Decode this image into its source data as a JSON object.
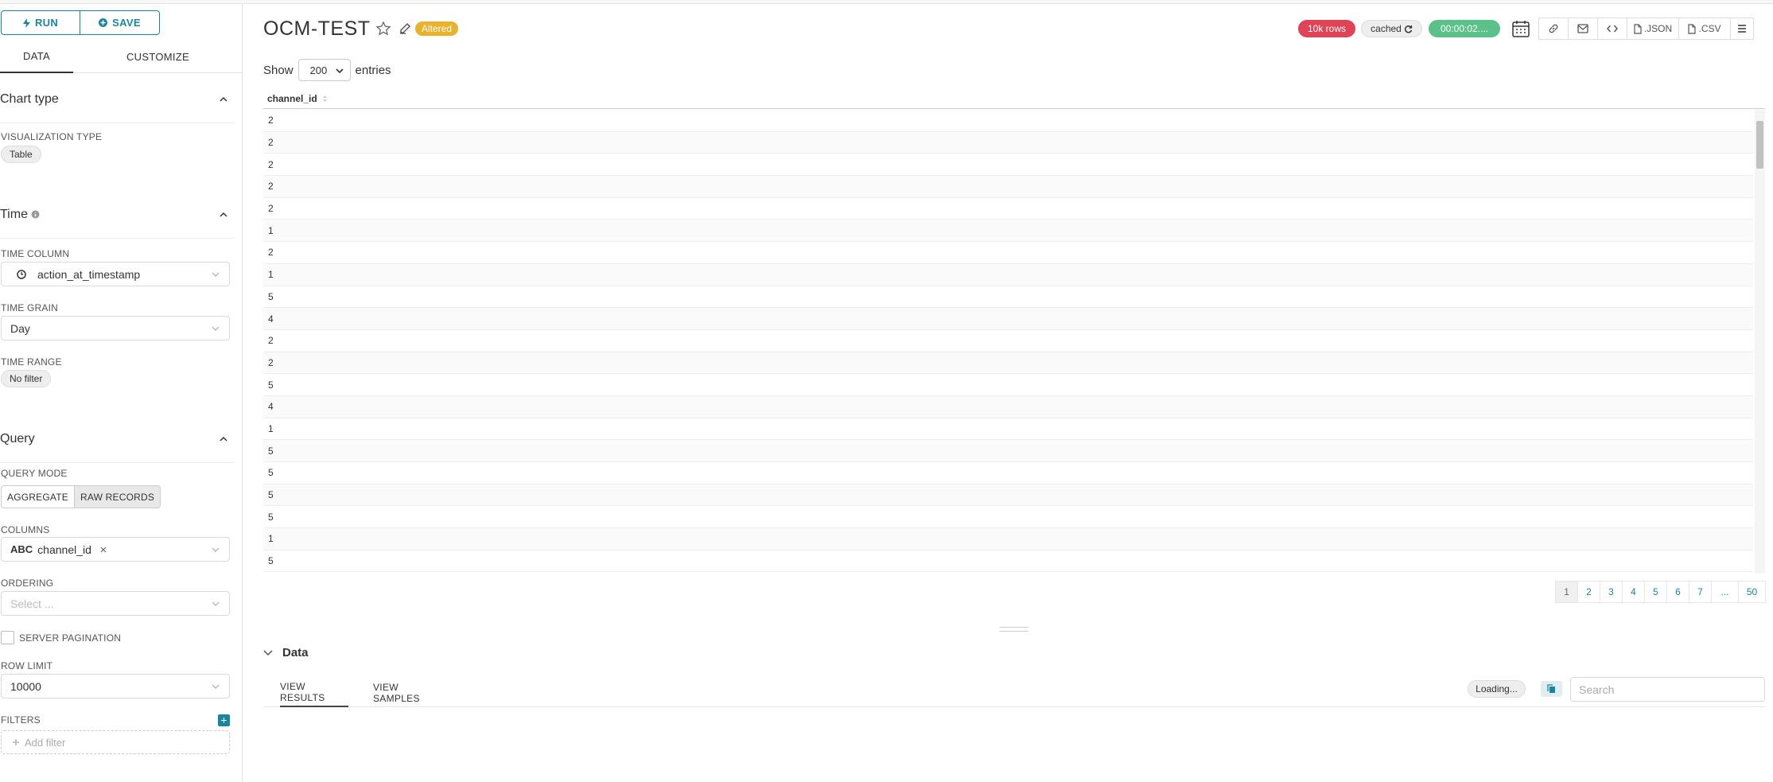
{
  "toolbar_left": {
    "run_label": "RUN",
    "save_label": "SAVE"
  },
  "left_tabs": {
    "data": "DATA",
    "customize": "CUSTOMIZE"
  },
  "chart_type": {
    "heading": "Chart type",
    "viz_label": "VISUALIZATION TYPE",
    "viz_value": "Table"
  },
  "time": {
    "heading": "Time",
    "column_label": "TIME COLUMN",
    "column_value": "action_at_timestamp",
    "grain_label": "TIME GRAIN",
    "grain_value": "Day",
    "range_label": "TIME RANGE",
    "range_value": "No filter"
  },
  "query": {
    "heading": "Query",
    "mode_label": "QUERY MODE",
    "mode_aggregate": "AGGREGATE",
    "mode_raw": "RAW RECORDS",
    "columns_label": "COLUMNS",
    "column_type": "ABC",
    "column_value": "channel_id",
    "ordering_label": "ORDERING",
    "ordering_placeholder": "Select ...",
    "server_pagination_label": "SERVER PAGINATION",
    "row_limit_label": "ROW LIMIT",
    "row_limit_value": "10000",
    "filters_label": "FILTERS",
    "add_filter": "Add filter"
  },
  "header": {
    "title": "OCM-TEST",
    "altered": "Altered",
    "rows_badge": "10k rows",
    "cached_badge": "cached",
    "time_badge": "00:00:02....",
    "json_label": ".JSON",
    "csv_label": ".CSV"
  },
  "colors": {
    "accent": "#1a85a0",
    "rows": "#e04355",
    "time": "#5ac189",
    "altered": "#e8b22a"
  },
  "table": {
    "show_label": "Show",
    "entries_label": "entries",
    "page_size": "200",
    "column_header": "channel_id",
    "rows": [
      "2",
      "2",
      "2",
      "2",
      "2",
      "1",
      "2",
      "1",
      "5",
      "4",
      "2",
      "2",
      "5",
      "4",
      "1",
      "5",
      "5",
      "5",
      "5",
      "1",
      "5"
    ]
  },
  "pagination": [
    "1",
    "2",
    "3",
    "4",
    "5",
    "6",
    "7",
    "...",
    "50"
  ],
  "data_panel": {
    "heading": "Data",
    "tab_results": "VIEW RESULTS",
    "tab_samples": "VIEW SAMPLES",
    "loading": "Loading...",
    "search_placeholder": "Search"
  }
}
